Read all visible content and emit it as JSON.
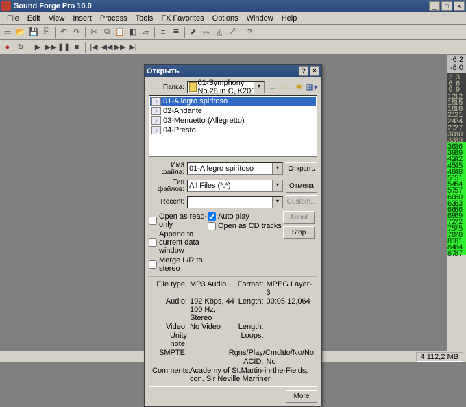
{
  "app": {
    "title": "Sound Forge Pro 10.0"
  },
  "menu": [
    "File",
    "Edit",
    "View",
    "Insert",
    "Process",
    "Tools",
    "FX Favorites",
    "Options",
    "Window",
    "Help"
  ],
  "meter": {
    "header_left": "-6,2",
    "header_right": "-8,0",
    "rows": [
      {
        "l": "3",
        "r": "3",
        "cls": "meter-dark"
      },
      {
        "l": "6",
        "r": "6",
        "cls": "meter-dark"
      },
      {
        "l": "9",
        "r": "9",
        "cls": "meter-dark"
      },
      {
        "l": "12",
        "r": "12",
        "cls": "meter-dark"
      },
      {
        "l": "15",
        "r": "15",
        "cls": "meter-dark"
      },
      {
        "l": "18",
        "r": "18",
        "cls": "meter-dark"
      },
      {
        "l": "21",
        "r": "21",
        "cls": "meter-dark"
      },
      {
        "l": "24",
        "r": "24",
        "cls": "meter-dark"
      },
      {
        "l": "27",
        "r": "27",
        "cls": "meter-dark"
      },
      {
        "l": "30",
        "r": "30",
        "cls": "meter-dark"
      },
      {
        "l": "33",
        "r": "33",
        "cls": "meter-dark"
      },
      {
        "l": "36",
        "r": "36",
        "cls": "meter-green"
      },
      {
        "l": "39",
        "r": "39",
        "cls": "meter-green"
      },
      {
        "l": "42",
        "r": "42",
        "cls": "meter-green"
      },
      {
        "l": "45",
        "r": "45",
        "cls": "meter-green"
      },
      {
        "l": "48",
        "r": "48",
        "cls": "meter-green"
      },
      {
        "l": "51",
        "r": "51",
        "cls": "meter-green"
      },
      {
        "l": "54",
        "r": "54",
        "cls": "meter-green"
      },
      {
        "l": "57",
        "r": "57",
        "cls": "meter-green"
      },
      {
        "l": "60",
        "r": "60",
        "cls": "meter-green"
      },
      {
        "l": "63",
        "r": "63",
        "cls": "meter-green"
      },
      {
        "l": "66",
        "r": "66",
        "cls": "meter-green"
      },
      {
        "l": "69",
        "r": "69",
        "cls": "meter-green"
      },
      {
        "l": "72",
        "r": "72",
        "cls": "meter-green"
      },
      {
        "l": "75",
        "r": "75",
        "cls": "meter-green"
      },
      {
        "l": "78",
        "r": "78",
        "cls": "meter-green"
      },
      {
        "l": "81",
        "r": "81",
        "cls": "meter-green"
      },
      {
        "l": "84",
        "r": "84",
        "cls": "meter-green"
      },
      {
        "l": "87",
        "r": "87",
        "cls": "meter-green"
      }
    ]
  },
  "status": {
    "memory": "4 112,2 MB"
  },
  "dialog": {
    "title": "Открыть",
    "folder_label": "Папка:",
    "folder_value": "01-Symphony No.28 in C, K200",
    "files": [
      {
        "name": "01-Allegro spiritoso",
        "selected": true
      },
      {
        "name": "02-Andante",
        "selected": false
      },
      {
        "name": "03-Menuetto (Allegretto)",
        "selected": false
      },
      {
        "name": "04-Presto",
        "selected": false
      }
    ],
    "filename_label": "Имя файла:",
    "filename_value": "01-Allegro spiritoso",
    "filetype_label": "Тип файлов:",
    "filetype_value": "All Files (*.*)",
    "recent_label": "Recent:",
    "recent_value": "",
    "btn_open": "Открыть",
    "btn_cancel": "Отмена",
    "btn_custom": "Custom...",
    "btn_about": "About",
    "btn_stop": "Stop",
    "btn_more": "More",
    "chk_readonly": "Open as read-only",
    "chk_autoplay": "Auto play",
    "chk_append": "Append to current data window",
    "chk_cdtracks": "Open as CD tracks",
    "chk_merge": "Merge L/R to stereo",
    "info": {
      "filetype_l": "File type:",
      "filetype_v": "MP3 Audio",
      "format_l": "Format:",
      "format_v": "MPEG Layer-3",
      "audio_l": "Audio:",
      "audio_v": "192 Kbps, 44 100 Hz, Stereo",
      "length_l": "Length:",
      "length_v": "00:05:12,064",
      "video_l": "Video:",
      "video_v": "No Video",
      "length2_l": "Length:",
      "length2_v": "",
      "unity_l": "Unity note:",
      "unity_v": "",
      "loops_l": "Loops:",
      "loops_v": "",
      "smpte_l": "SMPTE:",
      "smpte_v": "",
      "rgns_l": "Rgns/Play/Cmds:",
      "rgns_v": "No/No/No",
      "acid_l": "ACID:",
      "acid_v": "No",
      "comments_l": "Comments:",
      "comments_v": "Academy of St.Martin-in-the-Fields; con. Sir Neville Marriner"
    }
  }
}
